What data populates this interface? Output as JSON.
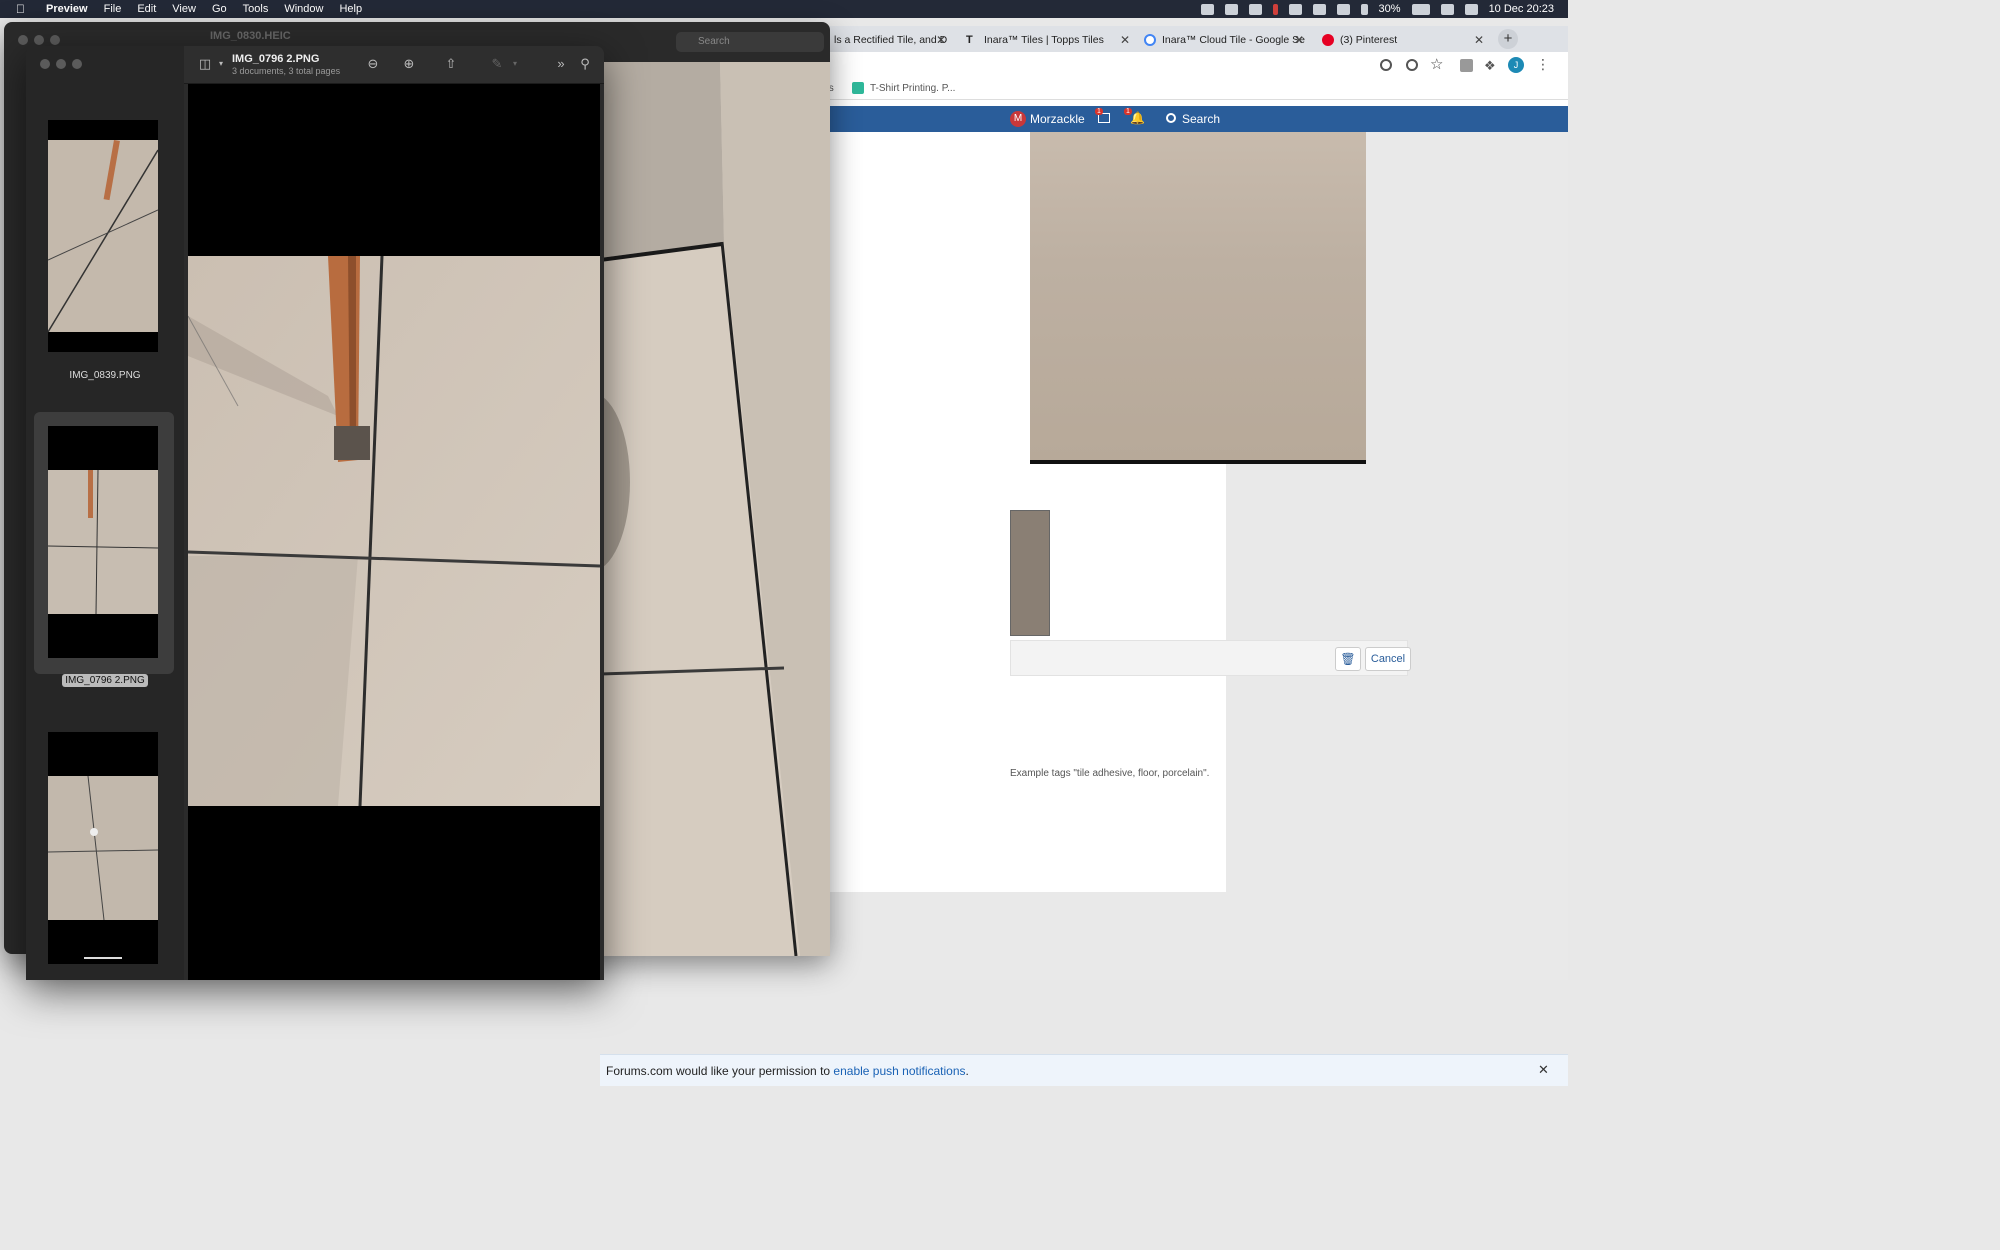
{
  "menubar": {
    "app_name": "Preview",
    "items": [
      "File",
      "Edit",
      "View",
      "Go",
      "Tools",
      "Window",
      "Help"
    ],
    "battery": "30%",
    "clock": "10 Dec  20:23"
  },
  "browser": {
    "tabs": [
      {
        "label": "ls a Rectified Tile, and D",
        "favicon_color": "#cfd3d8"
      },
      {
        "label": "Inara™ Tiles | Topps Tiles",
        "favicon": "T"
      },
      {
        "label": "Inara™ Cloud Tile - Google Se",
        "favicon_color": "#4285f4"
      },
      {
        "label": "(3) Pinterest",
        "favicon_color": "#e60023"
      }
    ],
    "bookmarks": [
      "ts",
      "T-Shirt Printing. P..."
    ],
    "profile_initial": "J"
  },
  "forum": {
    "username": "Morzackle",
    "avatar_initial": "M",
    "inbox_badge": "1",
    "alerts_badge": "1",
    "search_label": "Search",
    "cancel_label": "Cancel",
    "tags_hint": "Example tags \"tile adhesive, floor, porcelain\".",
    "notification_prefix": "Forums.com would like your permission to ",
    "notification_link": "enable push notifications",
    "notification_suffix": "."
  },
  "preview_back": {
    "title": "IMG_0830.HEIC",
    "search_placeholder": "Search"
  },
  "preview_front": {
    "title": "IMG_0796 2.PNG",
    "subtitle": "3 documents, 3 total pages",
    "thumbnails": [
      {
        "label": "IMG_0839.PNG",
        "selected": false
      },
      {
        "label": "IMG_0796 2.PNG",
        "selected": true
      },
      {
        "label": "",
        "selected": false
      }
    ]
  }
}
